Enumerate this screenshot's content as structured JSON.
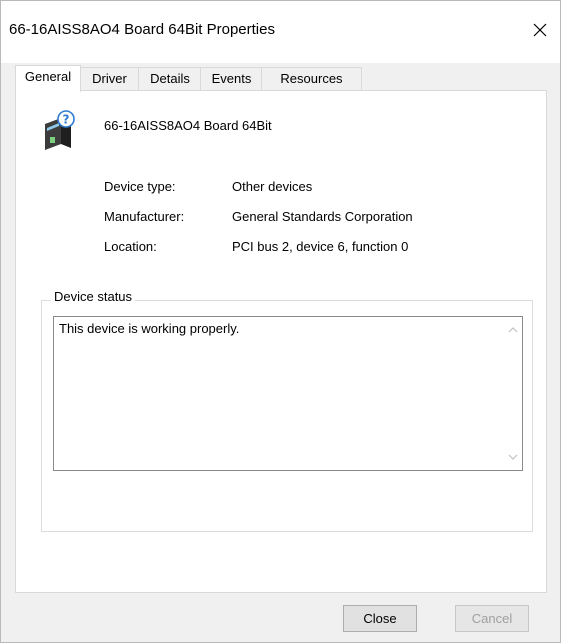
{
  "window": {
    "title": "66-16AISS8AO4 Board 64Bit Properties",
    "close_glyph": "✕"
  },
  "tabs": [
    {
      "label": "General",
      "active": true
    },
    {
      "label": "Driver",
      "active": false
    },
    {
      "label": "Details",
      "active": false
    },
    {
      "label": "Events",
      "active": false
    },
    {
      "label": "Resources",
      "active": false
    }
  ],
  "device": {
    "name": "66-16AISS8AO4 Board 64Bit",
    "icon": "unknown-device-icon"
  },
  "properties": [
    {
      "label": "Device type:",
      "value": "Other devices"
    },
    {
      "label": "Manufacturer:",
      "value": "General Standards Corporation"
    },
    {
      "label": "Location:",
      "value": "PCI bus 2, device 6, function 0"
    }
  ],
  "status": {
    "legend": "Device status",
    "text": "This device is working properly."
  },
  "buttons": {
    "close": "Close",
    "cancel": "Cancel"
  },
  "colors": {
    "accent": "#1e7ad6",
    "disabled_text": "#a0a0a0"
  }
}
